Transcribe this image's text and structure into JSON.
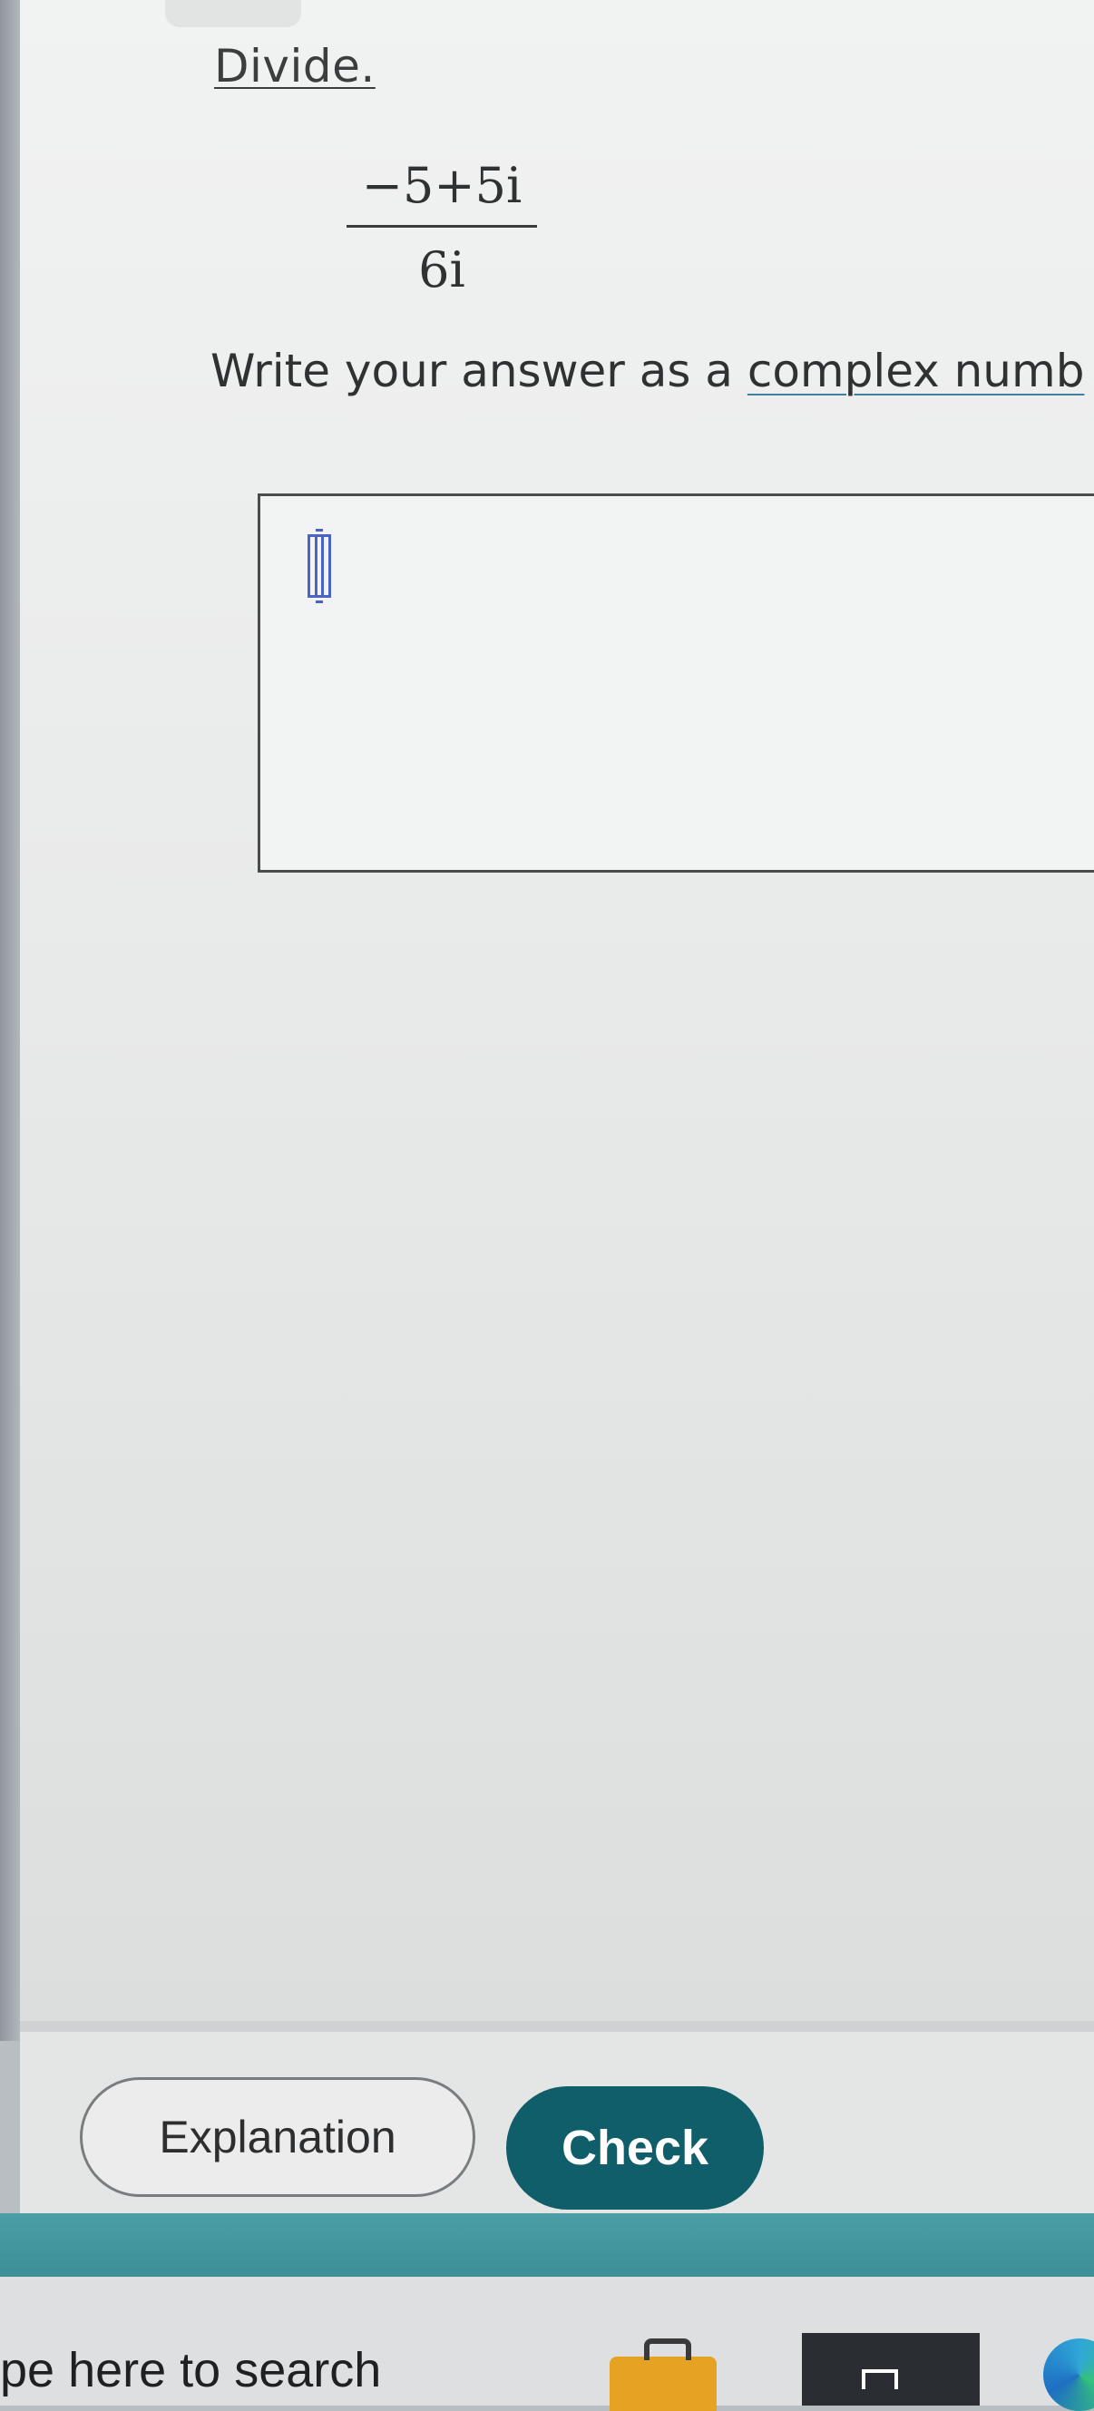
{
  "question": {
    "prompt_label": "Divide.",
    "fraction": {
      "numerator": "−5+5i",
      "denominator": "6i"
    },
    "instruction_prefix": "Write your answer as a ",
    "instruction_link": "complex numb"
  },
  "answer": {
    "value": ""
  },
  "buttons": {
    "explanation": "Explanation",
    "check": "Check"
  },
  "taskbar": {
    "search_placeholder": "pe here to search",
    "icons": [
      "briefcase-icon",
      "task-view-icon",
      "edge-icon"
    ]
  },
  "colors": {
    "check_button": "#0f5e6a",
    "cursor": "#4b63c9",
    "teal_band": "#3c8f96"
  }
}
